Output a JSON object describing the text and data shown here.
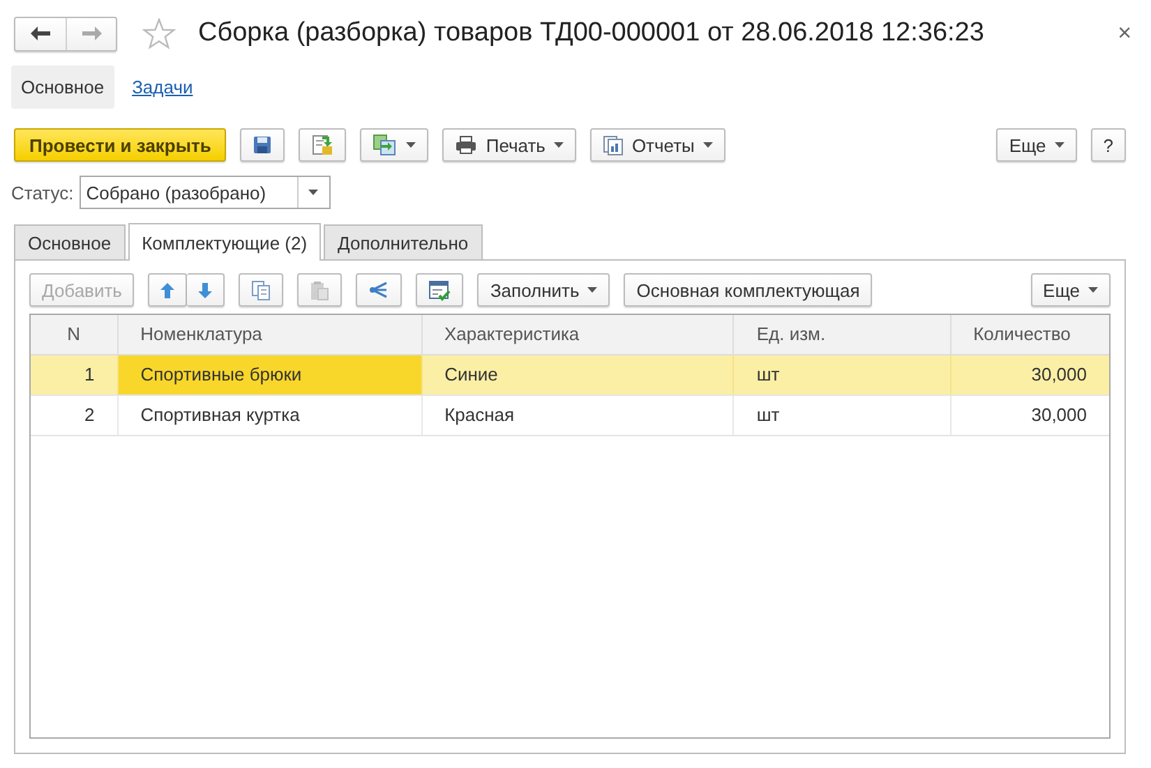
{
  "window": {
    "title": "Сборка (разборка) товаров ТД00-000001 от 28.06.2018 12:36:23",
    "close": "×"
  },
  "sections": [
    {
      "label": "Основное",
      "selected": true
    },
    {
      "label": "Задачи",
      "selected": false
    }
  ],
  "command_bar": [
    {
      "kind": "primary",
      "label": "Провести и закрыть"
    },
    {
      "kind": "icon"
    },
    {
      "kind": "icon"
    },
    {
      "kind": "icon-menu"
    },
    {
      "kind": "icon-text-menu",
      "label": "Печать"
    },
    {
      "kind": "icon-text-menu",
      "label": "Отчеты"
    },
    {
      "kind": "spacer"
    },
    {
      "kind": "text-menu",
      "label": "Еще"
    },
    {
      "kind": "text",
      "label": "?"
    }
  ],
  "status": {
    "label": "Статус:",
    "value": "Собрано (разобрано)"
  },
  "tabs": [
    {
      "label": "Основное",
      "selected": false
    },
    {
      "label": "Комплектующие (2)",
      "selected": true
    },
    {
      "label": "Дополнительно",
      "selected": false
    }
  ],
  "table_toolbar": [
    {
      "kind": "text",
      "label": "Добавить",
      "disabled": true
    },
    {
      "kind": "icon-pair",
      "disabled": false
    },
    {
      "kind": "icon",
      "disabled": false
    },
    {
      "kind": "icon",
      "disabled": true
    },
    {
      "kind": "icon",
      "disabled": false
    },
    {
      "kind": "icon",
      "disabled": false
    },
    {
      "kind": "text-menu",
      "label": "Заполнить",
      "disabled": false
    },
    {
      "kind": "text",
      "label": "Основная комплектующая",
      "disabled": false
    },
    {
      "kind": "spacer"
    },
    {
      "kind": "text-menu",
      "label": "Еще",
      "disabled": false
    }
  ],
  "table": {
    "columns": [
      "N",
      "Номенклатура",
      "Характеристика",
      "Ед. изм.",
      "Количество"
    ],
    "rows": [
      {
        "selected": true,
        "cells": [
          {
            "text": "1",
            "current": false
          },
          {
            "text": "Спортивные брюки",
            "current": true
          },
          {
            "text": "Синие",
            "current": false
          },
          {
            "text": "шт",
            "current": false
          },
          {
            "text": "30,000",
            "current": false
          }
        ]
      },
      {
        "selected": false,
        "cells": [
          {
            "text": "2",
            "current": false
          },
          {
            "text": "Спортивная куртка",
            "current": false
          },
          {
            "text": "Красная",
            "current": false
          },
          {
            "text": "шт",
            "current": false
          },
          {
            "text": "30,000",
            "current": false
          }
        ]
      }
    ]
  }
}
